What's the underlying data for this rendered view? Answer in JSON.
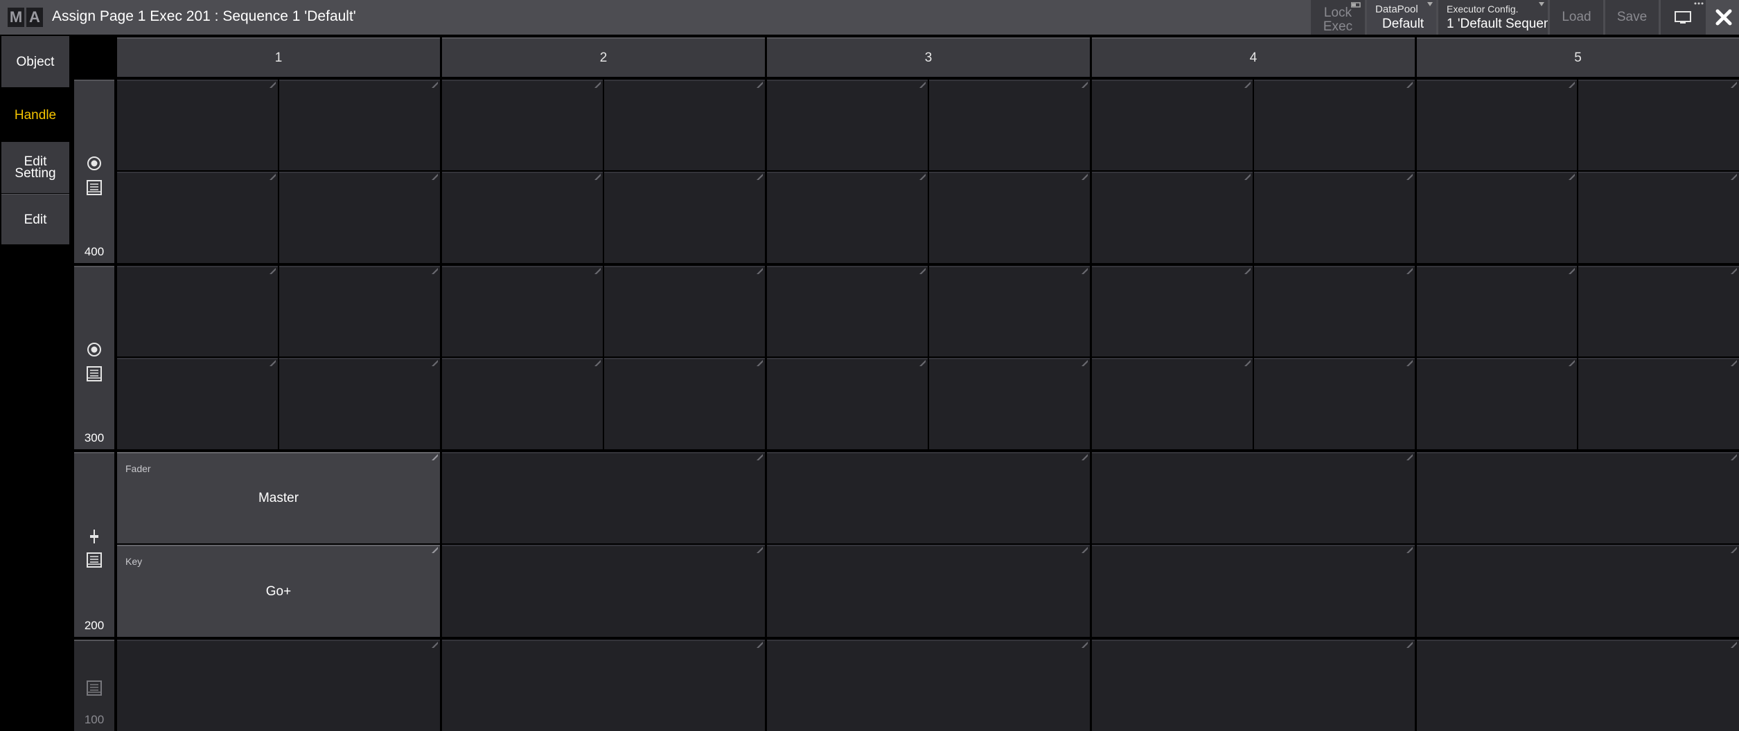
{
  "app": {
    "logo_letters": [
      "M",
      "A"
    ],
    "title": "Assign Page 1 Exec 201 : Sequence 1 'Default'"
  },
  "toolbar": {
    "lock_exec": "Lock\nExec",
    "lock_exec_line1": "Lock",
    "lock_exec_line2": "Exec",
    "datapool_label": "DataPool",
    "datapool_value": "Default",
    "exec_config_label": "Executor Config.",
    "exec_config_value": "1 'Default Sequenc",
    "load_label": "Load",
    "save_label": "Save",
    "icons": [
      "screen-icon",
      "close-icon",
      "more-icon"
    ]
  },
  "sidebar": {
    "object": "Object",
    "handle": "Handle",
    "edit_setting_line1": "Edit",
    "edit_setting_line2": "Setting",
    "edit": "Edit",
    "handle_color": "#f5c400"
  },
  "grid": {
    "columns": [
      "1",
      "2",
      "3",
      "4",
      "5"
    ],
    "rows": [
      {
        "number": "400",
        "icons": [
          "radio-icon",
          "executor-icon"
        ]
      },
      {
        "number": "300",
        "icons": [
          "radio-icon",
          "executor-icon"
        ]
      },
      {
        "number": "200",
        "icons": [
          "fader-icon",
          "executor-icon"
        ]
      },
      {
        "number": "100",
        "icons": [
          "executor-icon"
        ]
      }
    ],
    "assigned": {
      "fader_label": "Fader",
      "fader_value": "Master",
      "key_label": "Key",
      "key_value": "Go+"
    }
  },
  "colors": {
    "titlebar": "#4d4d52",
    "background": "#000000",
    "cell": "#222226",
    "cell_filled": "#414146",
    "accent": "#f5c400"
  }
}
